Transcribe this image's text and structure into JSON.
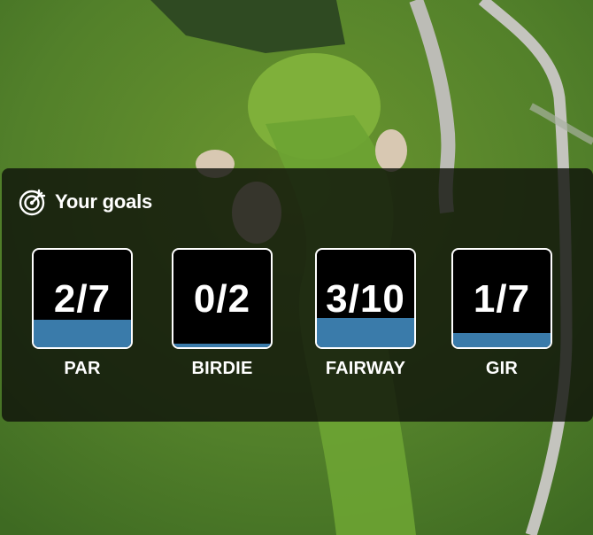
{
  "header": {
    "title": "Your goals",
    "icon": "target-arrow-icon"
  },
  "colors": {
    "progress_fill": "#3a7baa",
    "box_background": "#000000",
    "box_border": "#ffffff"
  },
  "goals": [
    {
      "label": "PAR",
      "value_text": "2/7",
      "done": 2,
      "target": 7
    },
    {
      "label": "BIRDIE",
      "value_text": "0/2",
      "done": 0,
      "target": 2
    },
    {
      "label": "FAIRWAY",
      "value_text": "3/10",
      "done": 3,
      "target": 10
    },
    {
      "label": "GIR",
      "value_text": "1/7",
      "done": 1,
      "target": 7
    }
  ]
}
